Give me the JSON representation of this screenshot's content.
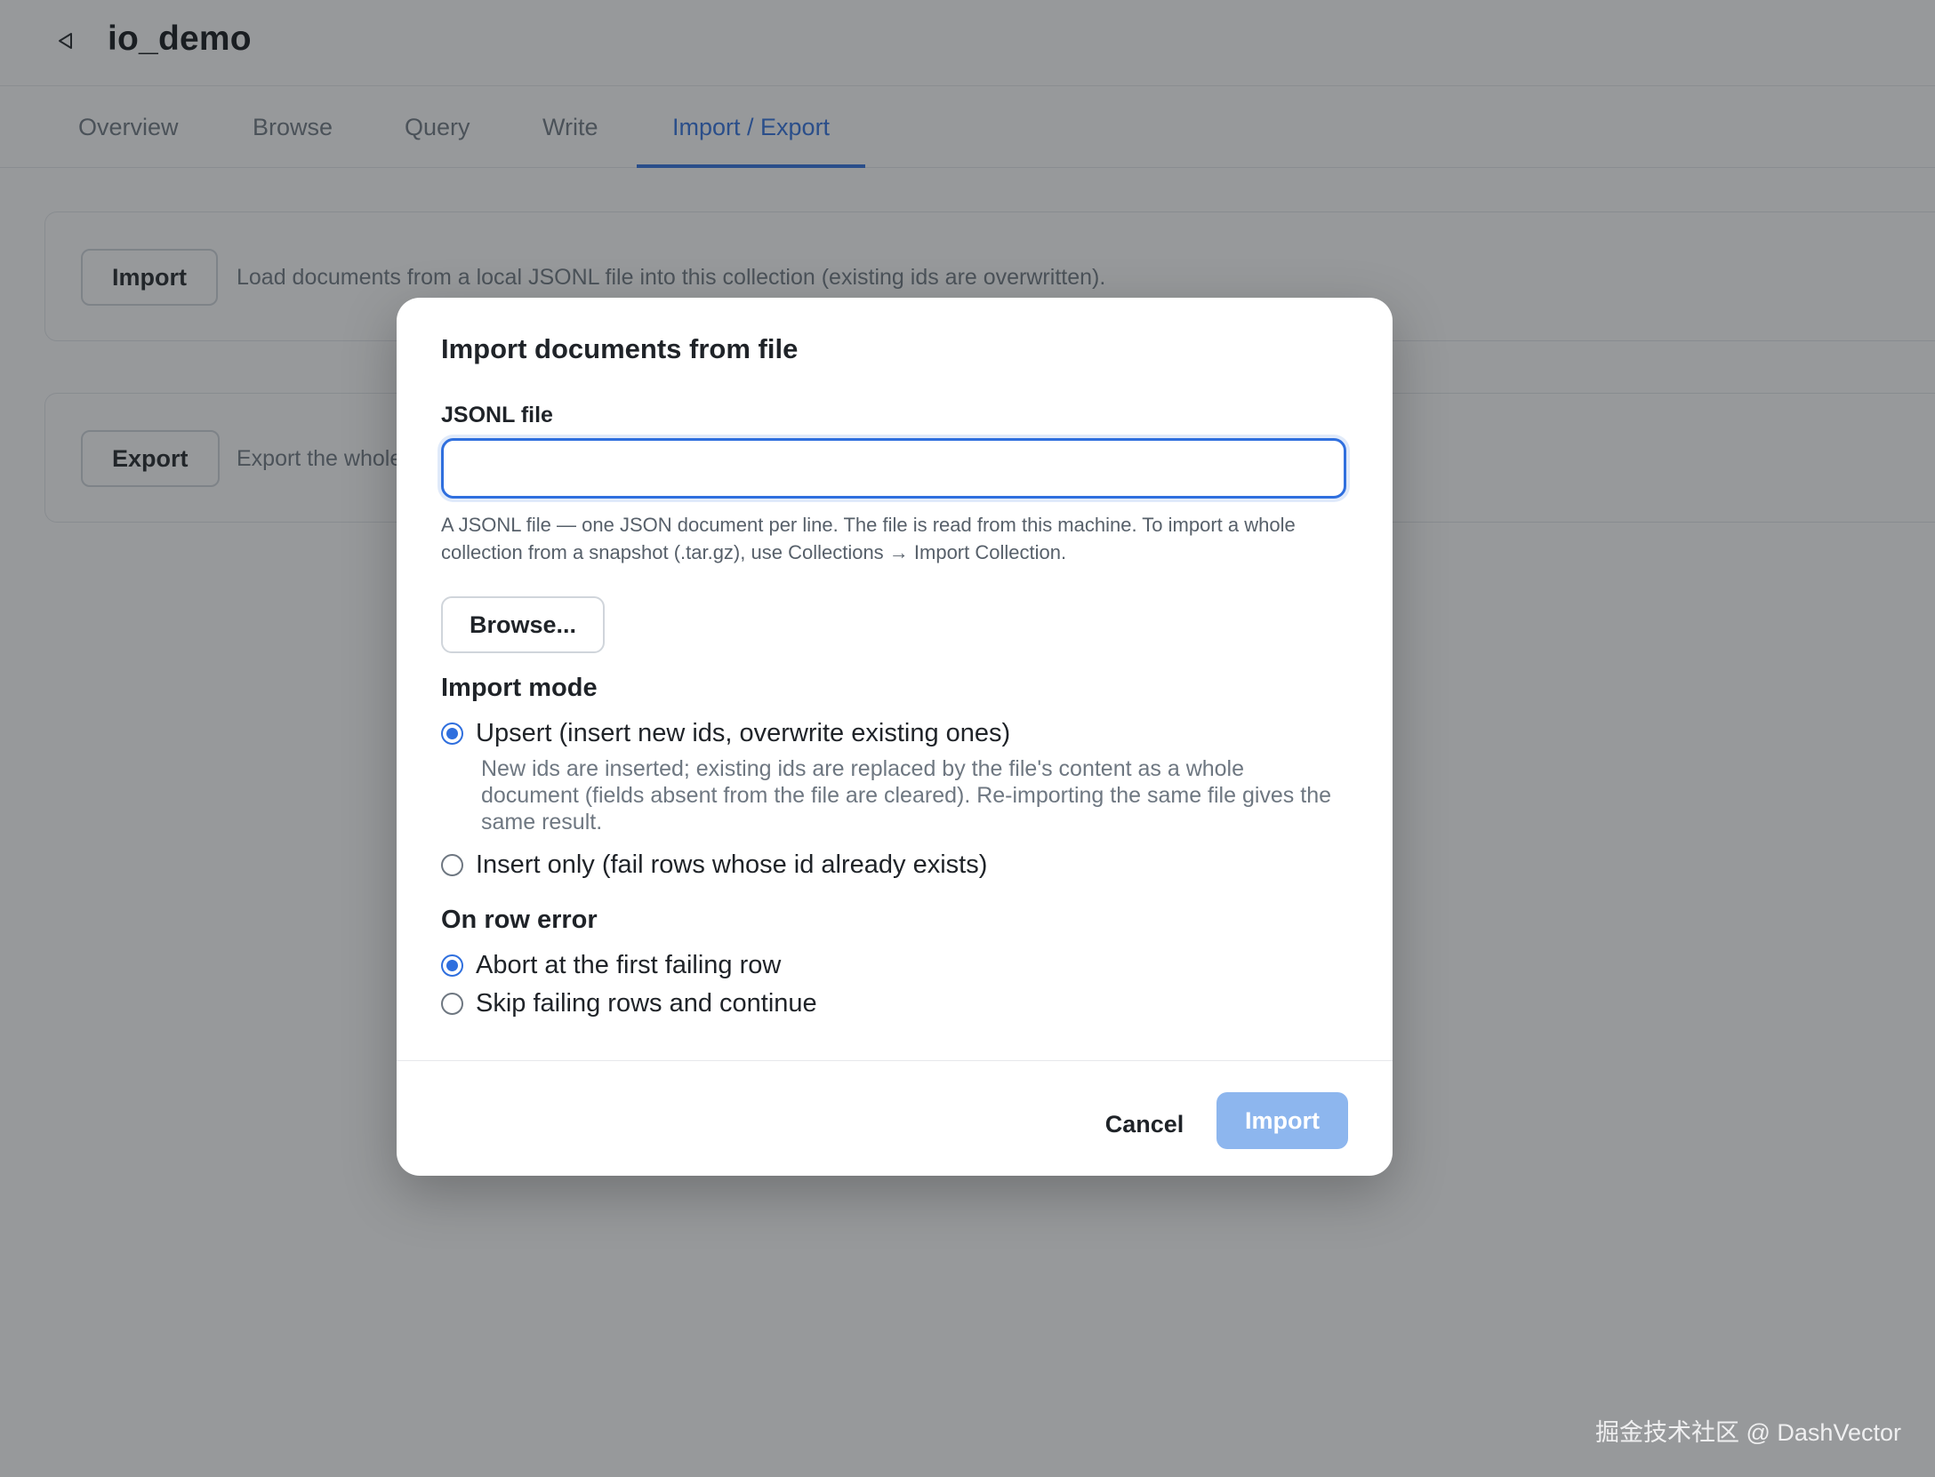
{
  "header": {
    "collection_title": "io_demo",
    "back_icon": "back-triangle-icon"
  },
  "tabs": [
    {
      "label": "Overview"
    },
    {
      "label": "Browse"
    },
    {
      "label": "Query"
    },
    {
      "label": "Write"
    },
    {
      "label": "Import / Export",
      "active": true
    }
  ],
  "import_card": {
    "button_label": "Import",
    "description": "Load documents from a local JSONL file into this collection (existing ids are overwritten)."
  },
  "export_card": {
    "button_label": "Export",
    "description": "Export the whole"
  },
  "modal": {
    "title": "Import documents from file",
    "file_label": "JSONL file",
    "file_value": "",
    "help_text": "A JSONL file — one JSON document per line. The file is read from this machine. To import a whole collection from a snapshot (.tar.gz), use Collections → Import Collection.",
    "browse_label": "Browse...",
    "import_mode": {
      "heading": "Import mode",
      "options": [
        {
          "label": "Upsert (insert new ids, overwrite existing ones)",
          "checked": true
        },
        {
          "label": "Insert only (fail rows whose id already exists)",
          "checked": false
        }
      ],
      "upsert_help": "New ids are inserted; existing ids are replaced by the file's content as a whole document (fields absent from the file are cleared). Re-importing the same file gives the same result."
    },
    "row_error": {
      "heading": "On row error",
      "options": [
        {
          "label": "Abort at the first failing row",
          "checked": true
        },
        {
          "label": "Skip failing rows and continue",
          "checked": false
        }
      ]
    },
    "cancel_label": "Cancel",
    "import_label": "Import"
  },
  "watermark": "掘金技术社区 @ DashVector",
  "colors": {
    "accent": "#2f6fde",
    "import_button_disabled": "#8db6ee",
    "overlay": "rgba(38,41,46,0.48)"
  }
}
